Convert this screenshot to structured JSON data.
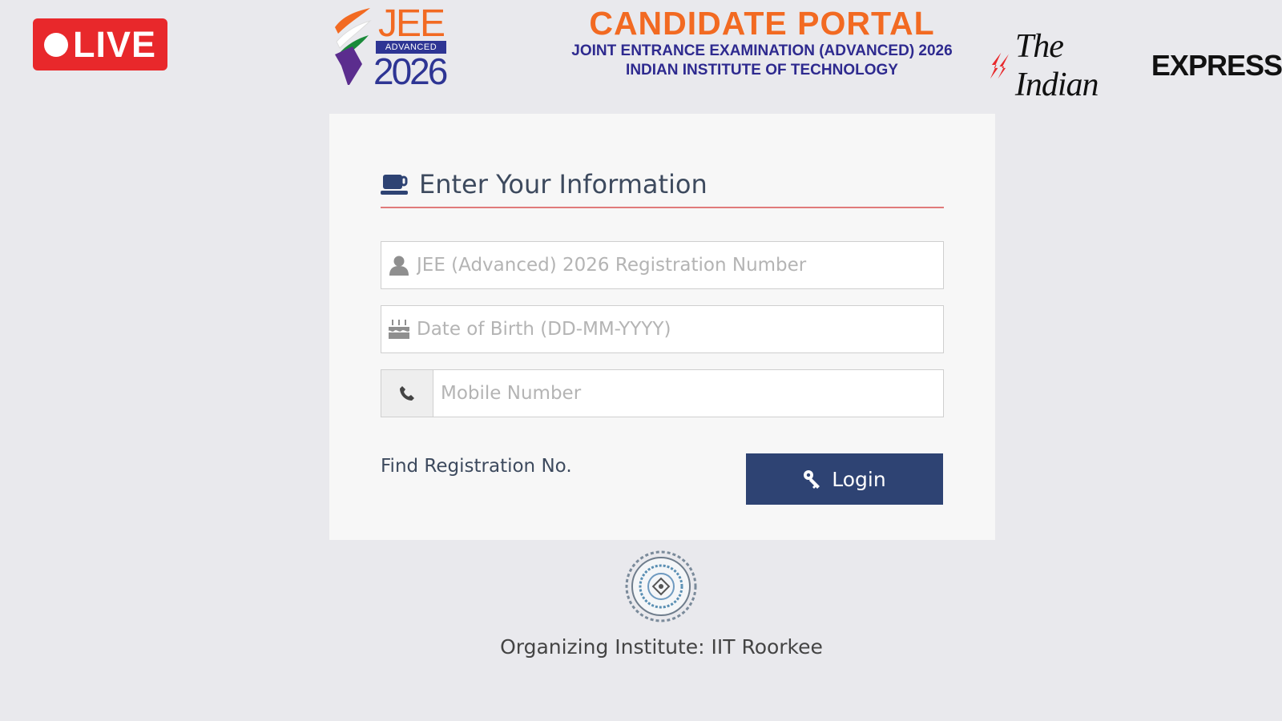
{
  "badge": {
    "live_label": "LIVE"
  },
  "logo": {
    "word": "JEE",
    "advanced": "ADVANCED",
    "year": "2026"
  },
  "portal": {
    "title": "CANDIDATE PORTAL",
    "subtitle1": "JOINT ENTRANCE EXAMINATION (ADVANCED) 2026",
    "subtitle2": "INDIAN INSTITUTE OF TECHNOLOGY"
  },
  "publisher": {
    "script": "The Indian",
    "bold": "EXPRESS"
  },
  "form": {
    "heading": "Enter Your Information",
    "registration_placeholder": "JEE (Advanced) 2026 Registration Number",
    "dob_placeholder": "Date of Birth (DD-MM-YYYY)",
    "mobile_placeholder": "Mobile Number",
    "find_link": "Find Registration No.",
    "login_label": "Login"
  },
  "footer": {
    "organizer": "Organizing Institute: IIT Roorkee"
  },
  "colors": {
    "accent_orange": "#f26a22",
    "brand_navy": "#2e3594",
    "login_button": "#2e4373",
    "live_red": "#e8282b",
    "divider_red": "#e07b7b"
  },
  "icons": [
    "user-icon",
    "cake-icon",
    "phone-icon",
    "key-icon",
    "coffee-cup-icon",
    "seal-icon"
  ]
}
